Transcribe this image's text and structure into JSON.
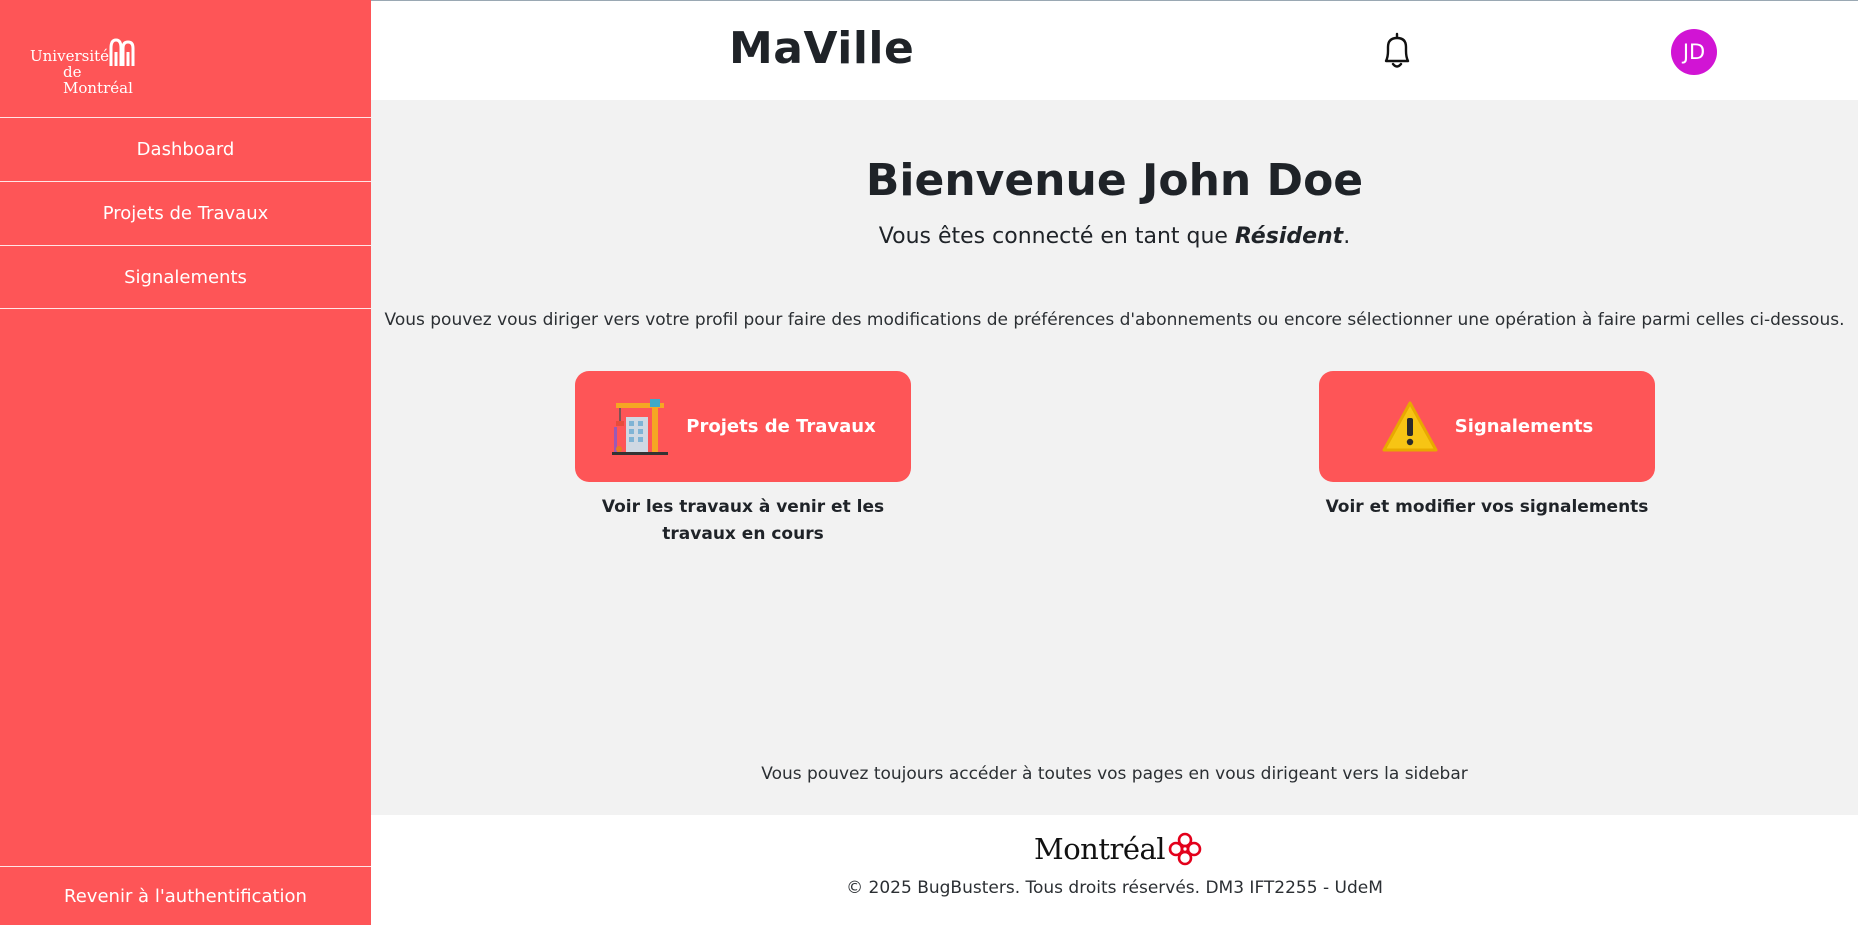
{
  "sidebar": {
    "logo_line1": "Université",
    "logo_line2": "de Montréal",
    "items": [
      {
        "label": "Dashboard"
      },
      {
        "label": "Projets de Travaux"
      },
      {
        "label": "Signalements"
      }
    ],
    "logout_label": "Revenir à l'authentification"
  },
  "header": {
    "title": "MaVille",
    "avatar_initials": "JD",
    "avatar_color": "#d114d4",
    "bell_icon": "bell-icon"
  },
  "main": {
    "welcome": "Bienvenue John Doe",
    "role_prefix": "Vous êtes connecté en tant que ",
    "role": "Résident",
    "role_suffix": ".",
    "intro": "Vous pouvez vous diriger vers votre profil pour faire des modifications de préférences d'abonnements ou encore sélectionner une opération à faire parmi celles ci-dessous.",
    "cards": [
      {
        "label": "Projets de Travaux",
        "icon": "construction-crane-icon",
        "description": "Voir les travaux à venir et les travaux en cours"
      },
      {
        "label": "Signalements",
        "icon": "warning-icon",
        "description": "Voir et modifier vos signalements"
      }
    ],
    "hint": "Vous pouvez toujours accéder à toutes vos pages en vous dirigeant vers la sidebar"
  },
  "footer": {
    "logo_text": "Montréal",
    "copyright": "© 2025 BugBusters. Tous droits réservés. DM3 IFT2255 - UdeM"
  },
  "colors": {
    "accent": "#fe5557",
    "background": "#f2f2f2"
  }
}
